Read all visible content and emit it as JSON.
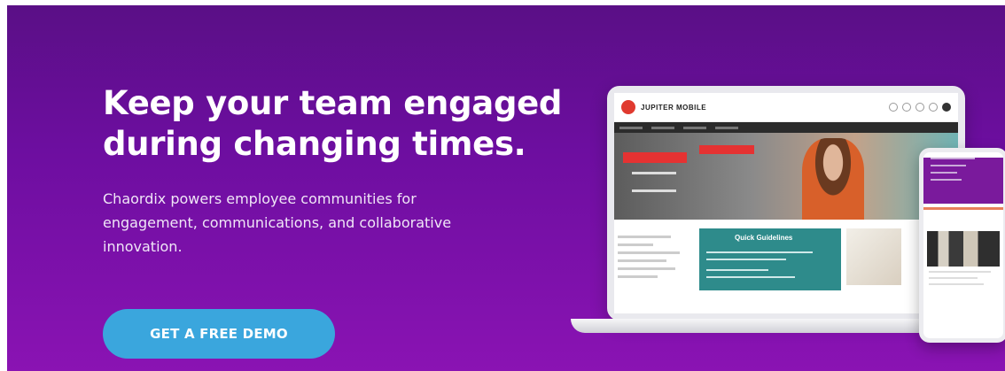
{
  "hero": {
    "headline_line1": "Keep your team engaged",
    "headline_line2": "during changing times.",
    "subtext": "Chaordix powers employee communities for engagement, communications, and collaborative innovation.",
    "cta_label": "GET A FREE DEMO"
  },
  "mockup": {
    "site_name": "JUPITER MOBILE",
    "panel_title": "Quick Guidelines"
  },
  "colors": {
    "background_top": "#5a0f86",
    "background_bottom": "#8a13b3",
    "cta": "#3aa6dd"
  }
}
